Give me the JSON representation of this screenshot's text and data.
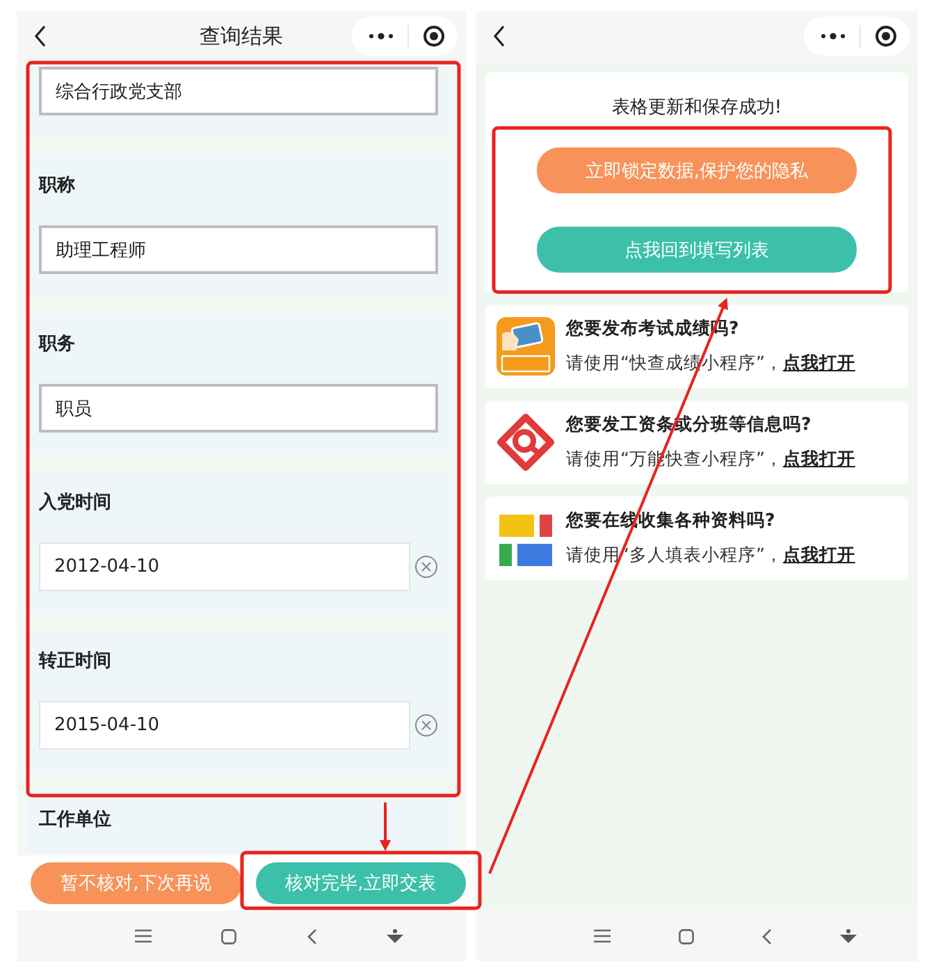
{
  "left_screen": {
    "title": "查询结果",
    "fields": [
      {
        "kind": "text",
        "value": "综合行政党支部"
      },
      {
        "kind": "text",
        "label": "职称",
        "value": "助理工程师"
      },
      {
        "kind": "text",
        "label": "职务",
        "value": "职员"
      },
      {
        "kind": "date",
        "label": "入党时间",
        "value": "2012-04-10"
      },
      {
        "kind": "date",
        "label": "转正时间",
        "value": "2015-04-10"
      },
      {
        "label": "工作单位"
      }
    ],
    "buttons": [
      {
        "kind": "secondary",
        "label": "暂不核对,下次再说"
      },
      {
        "kind": "primary",
        "label": "核对完毕,立即交表"
      }
    ]
  },
  "right_screen": {
    "message": "表格更新和保存成功!",
    "buttons": [
      {
        "kind": "secondary",
        "label": "立即锁定数据,保护您的隐私"
      },
      {
        "kind": "primary",
        "label": "点我回到填写列表"
      }
    ],
    "promos": [
      {
        "kind": "score",
        "title": "您要发布考试成绩吗?",
        "text": "请使用“快查成绩小程序”，",
        "link": "点我打开"
      },
      {
        "kind": "search",
        "title": "您要发工资条或分班等信息吗?",
        "text": "请使用“万能快查小程序”，",
        "link": "点我打开"
      },
      {
        "kind": "blocks",
        "title": "您要在线收集各种资料吗?",
        "text": "请使用“多人填表小程序”，",
        "link": "点我打开"
      }
    ]
  }
}
